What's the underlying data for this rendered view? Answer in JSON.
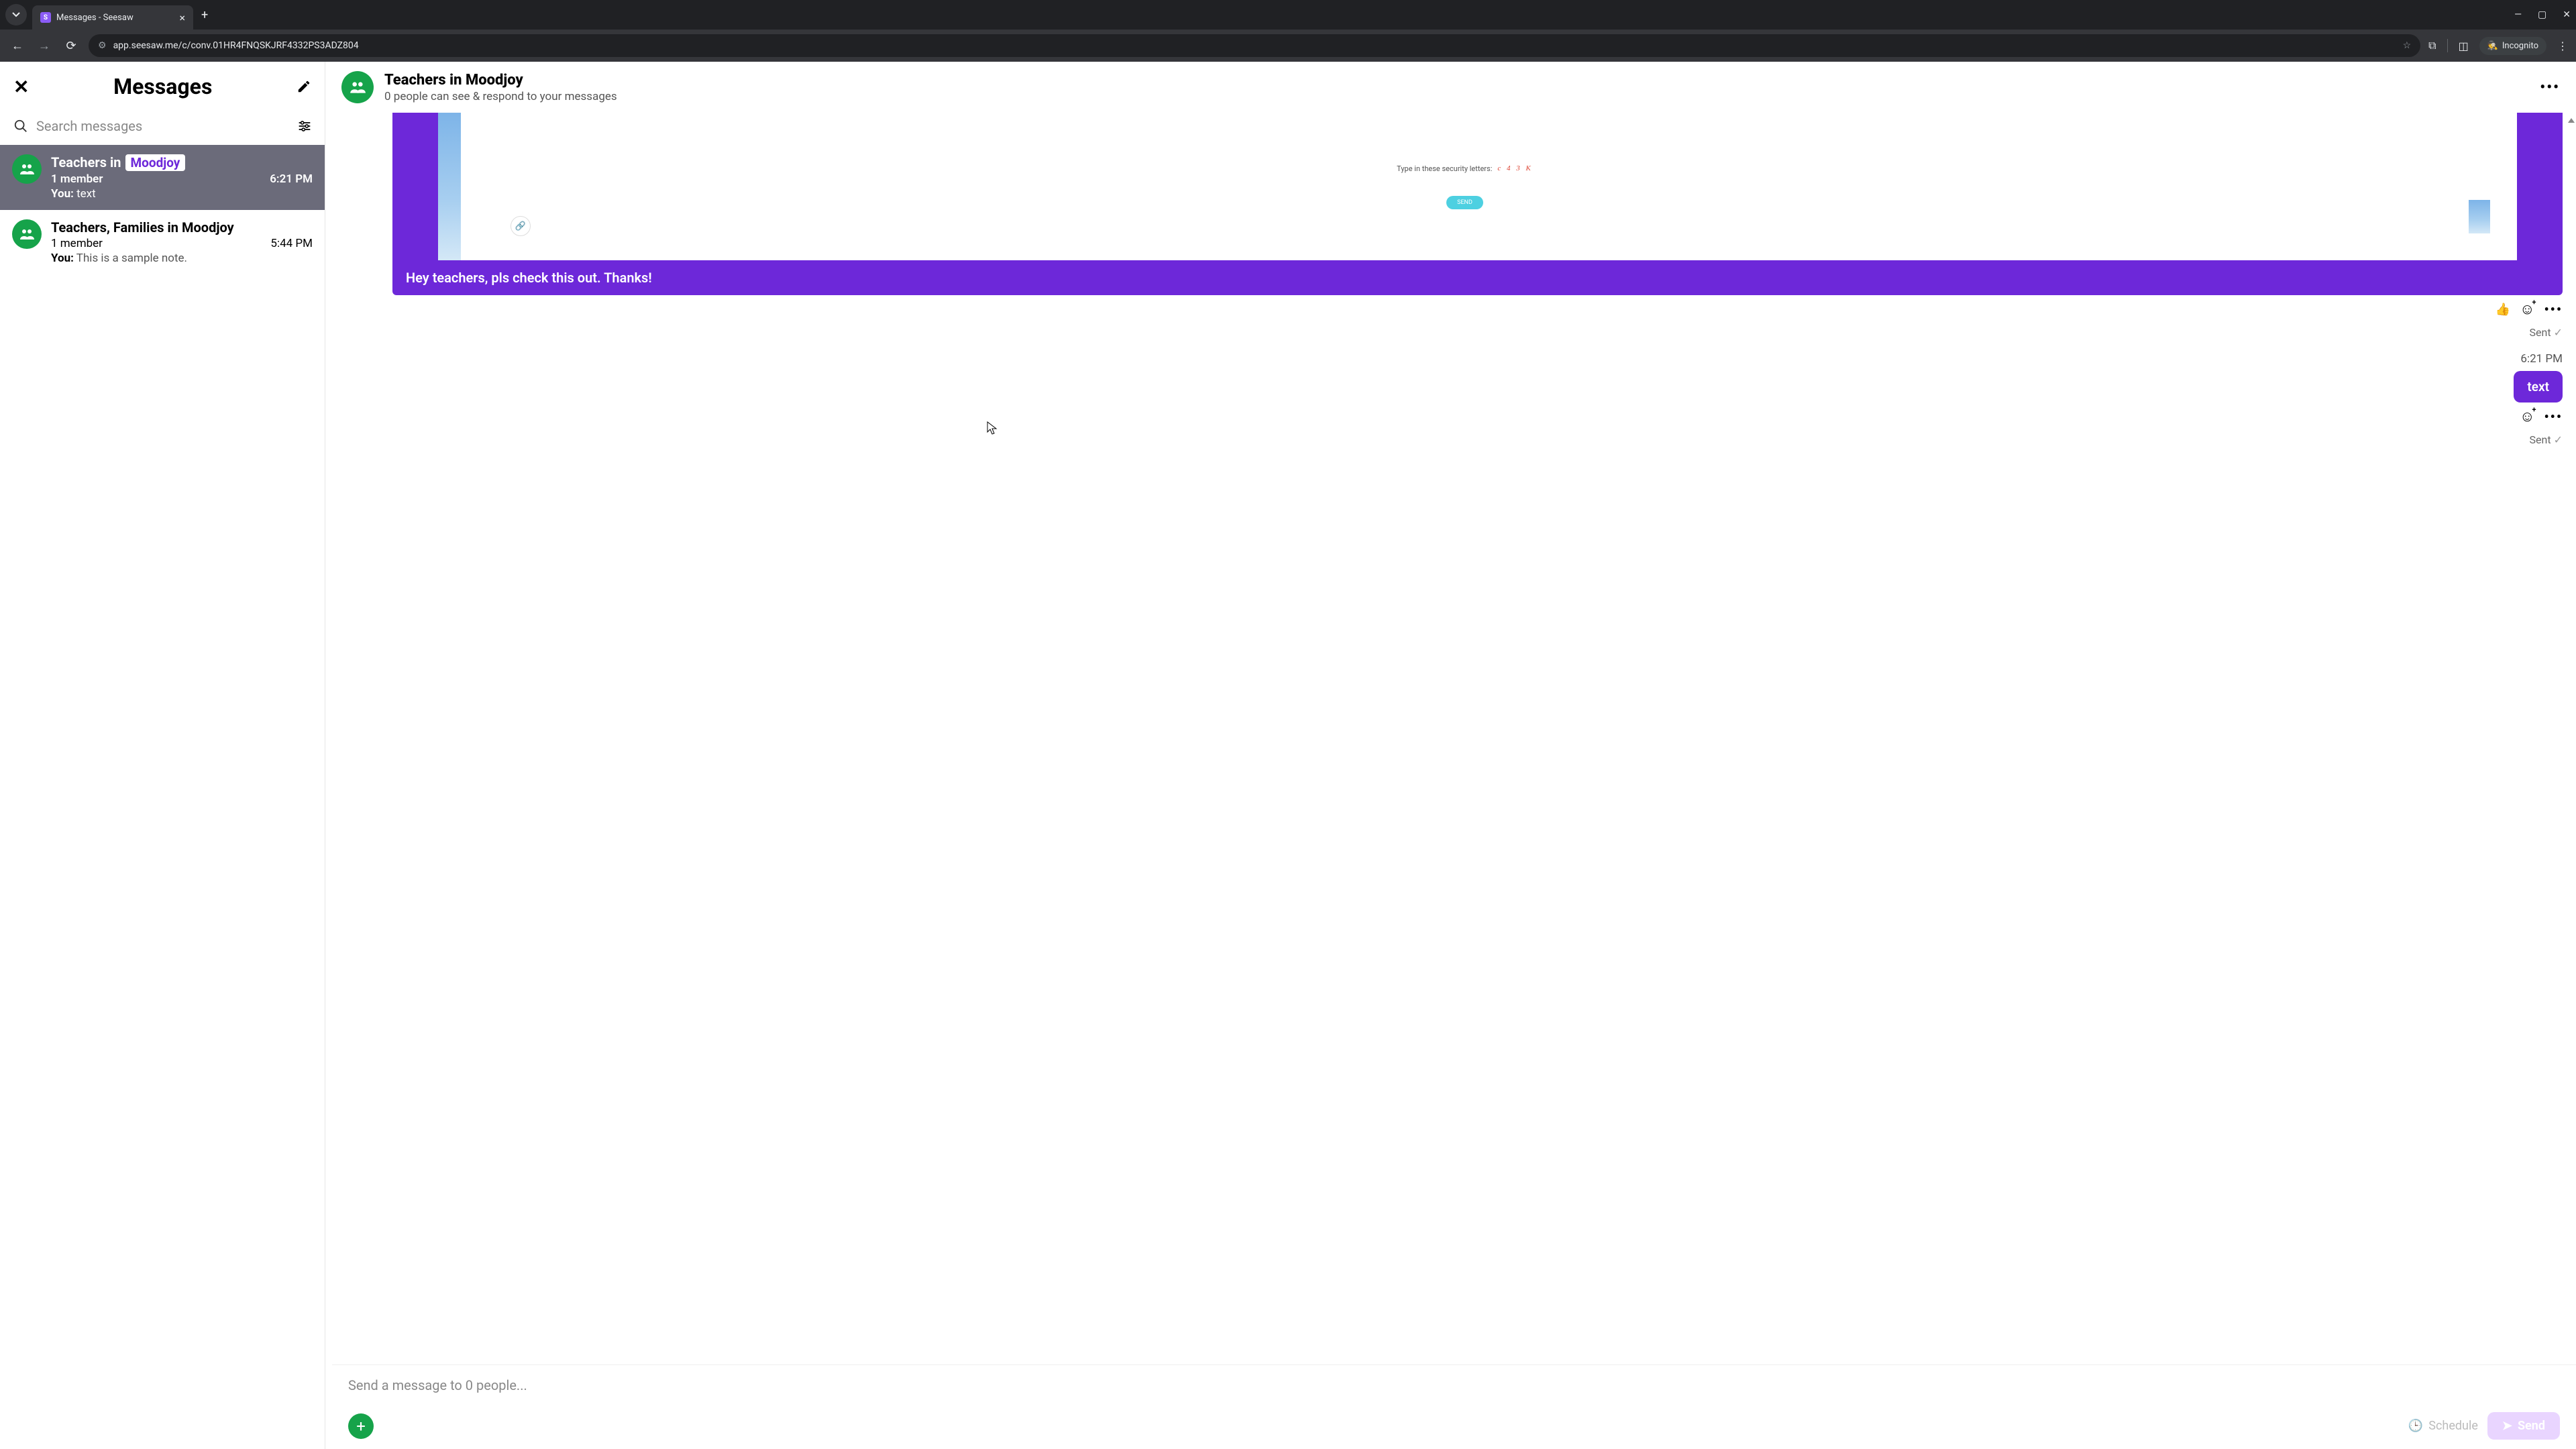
{
  "browser": {
    "tab_title": "Messages - Seesaw",
    "url": "app.seesaw.me/c/conv.01HR4FNQSKJRF4332PS3ADZ804",
    "incognito_label": "Incognito"
  },
  "sidebar": {
    "title": "Messages",
    "search_placeholder": "Search messages",
    "conversations": [
      {
        "title_prefix": "Teachers in",
        "title_badge": "Moodjoy",
        "members": "1 member",
        "time": "6:21 PM",
        "preview_you": "You:",
        "preview_text": "text",
        "active": true
      },
      {
        "title_full": "Teachers, Families in  Moodjoy",
        "members": "1 member",
        "time": "5:44 PM",
        "preview_you": "You:",
        "preview_text": "This is a sample note.",
        "active": false
      }
    ]
  },
  "main": {
    "title": "Teachers in  Moodjoy",
    "subtitle": "0 people can see & respond to your messages",
    "attachment": {
      "security_prompt": "Type in these security letters:",
      "captcha": "c 4 3 K",
      "send_label": "SEND",
      "caption": "Hey teachers, pls check this out. Thanks!"
    },
    "status1": "Sent",
    "msg2_time": "6:21 PM",
    "msg2_text": "text",
    "status2": "Sent"
  },
  "composer": {
    "placeholder": "Send a message to 0 people...",
    "schedule_label": "Schedule",
    "send_label": "Send"
  }
}
